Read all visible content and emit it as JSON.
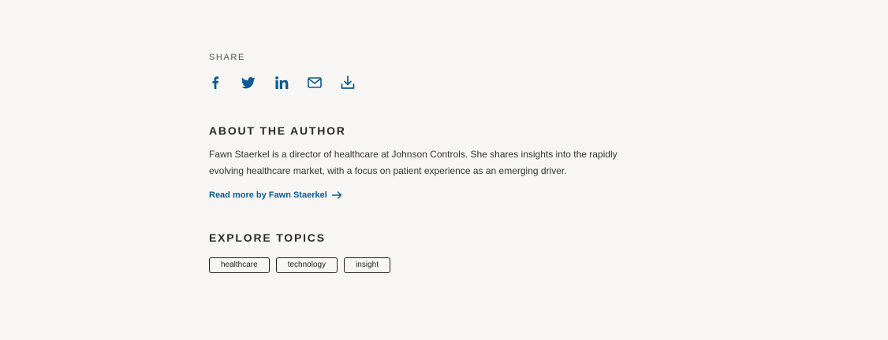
{
  "share": {
    "label": "SHARE",
    "icons": [
      "facebook-icon",
      "twitter-icon",
      "linkedin-icon",
      "email-icon",
      "download-icon"
    ]
  },
  "about": {
    "title": "ABOUT THE AUTHOR",
    "bio": "Fawn Staerkel is a director of healthcare at Johnson Controls. She shares insights into the rapidly evolving healthcare market, with a focus on patient experience as an emerging driver.",
    "read_more": "Read more by Fawn Staerkel"
  },
  "topics": {
    "title": "EXPLORE TOPICS",
    "tags": [
      "healthcare",
      "technology",
      "insight"
    ]
  },
  "colors": {
    "accent": "#0a5a96",
    "background": "#f7f6f4"
  }
}
